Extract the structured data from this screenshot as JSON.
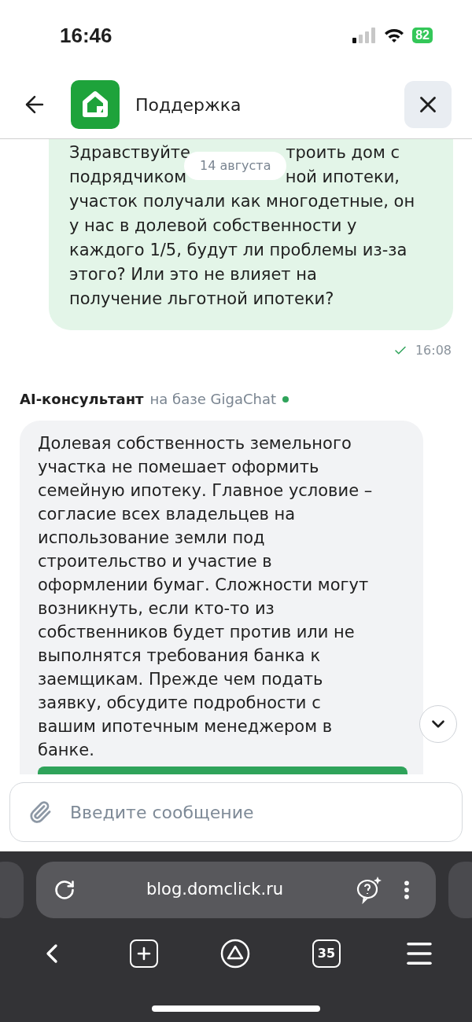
{
  "status_bar": {
    "time": "16:46",
    "battery": "82"
  },
  "header": {
    "title": "Поддержка"
  },
  "user_message": {
    "covered_lines": [
      {
        "left": "Здравствуйте",
        "right": "троить дом с"
      },
      {
        "left": "подрядчиком",
        "right": "ной ипотеки,"
      }
    ],
    "lines": [
      "участок получали как многодетные, он",
      "у нас в долевой собственности у",
      "каждого 1/5, будут ли проблемы из-за",
      "этого? Или это не влияет на",
      "получение льготной ипотеки?"
    ],
    "date": "14 августа",
    "read": true,
    "time": "16:08"
  },
  "bot": {
    "name": "AI-консультант",
    "subtitle": "на базе GigaChat",
    "online": true,
    "lines": [
      "Долевая собственность земельного",
      "участка не помешает оформить",
      "семейную ипотеку. Главное условие –",
      "согласие всех владельцев на",
      "использование земли под",
      "строительство и участие в",
      "оформлении бумаг. Сложности могут",
      "возникнуть, если кто-то из",
      "собственников будет против или не",
      "выполнятся требования банка к",
      "заемщикам. Прежде чем подать",
      "заявку, обсудите подробности с",
      "вашим ипотечным менеджером в",
      "банке."
    ]
  },
  "composer": {
    "placeholder": "Введите сообщение"
  },
  "browser": {
    "url": "blog.domclick.ru",
    "tabs_count": "35"
  }
}
